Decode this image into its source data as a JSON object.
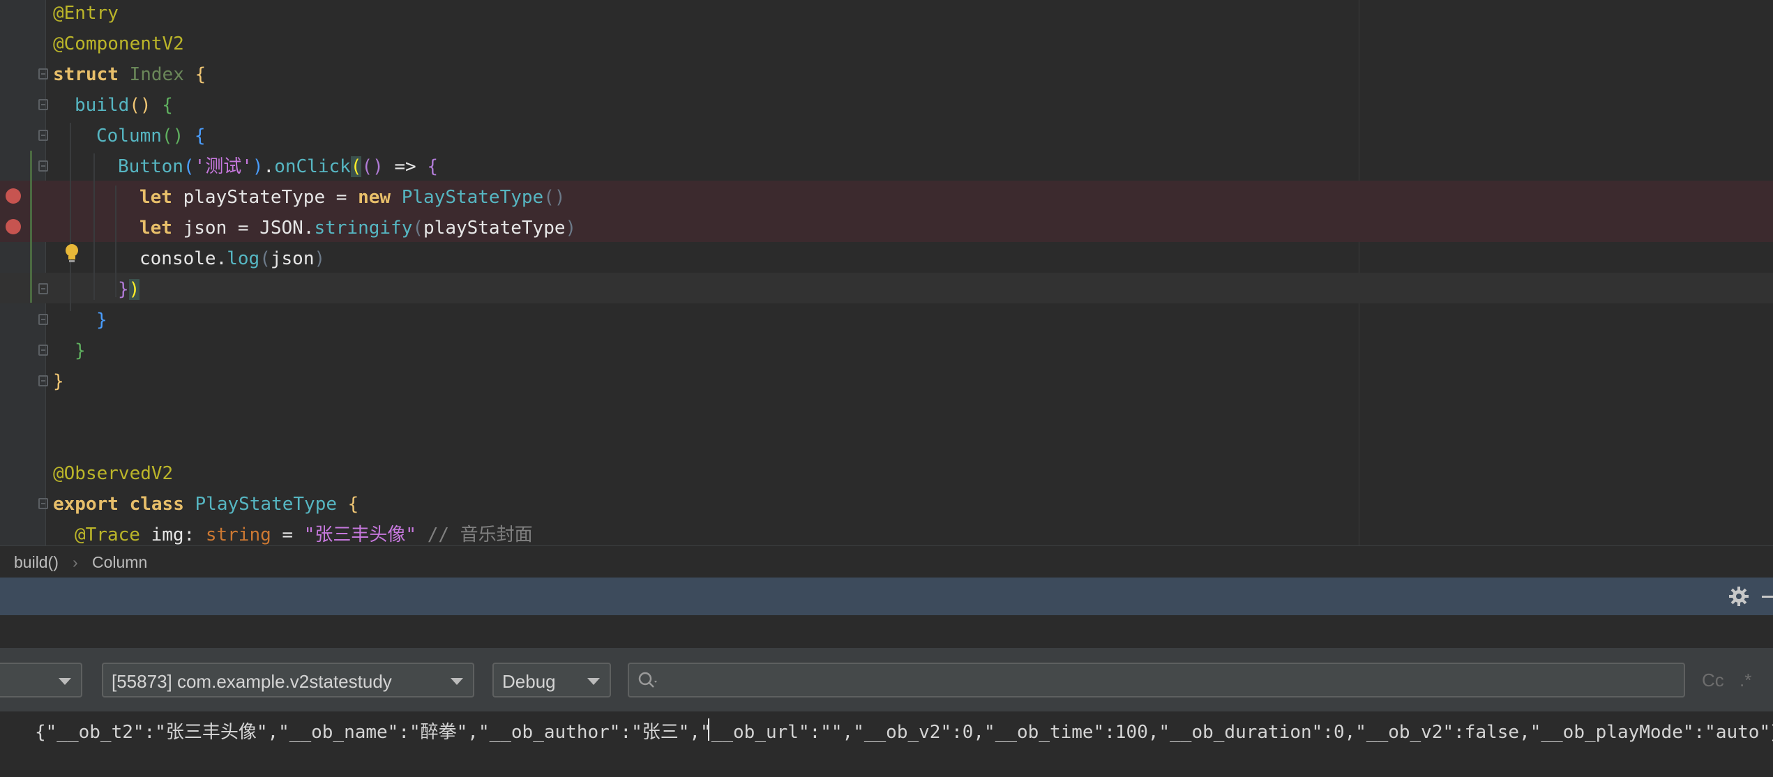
{
  "editor": {
    "lines": {
      "l1": {
        "ann": "@Entry"
      },
      "l2": {
        "ann": "@ComponentV2"
      },
      "l3": {
        "kw": "struct",
        "cls": "Index",
        "brace": "{"
      },
      "l4": {
        "fn": "build",
        "paren": "()",
        "brace": "{"
      },
      "l5": {
        "type": "Column",
        "paren": "()",
        "brace": "{"
      },
      "l6": {
        "type": "Button",
        "open": "(",
        "str": "'测试'",
        "close": ")",
        "dot": ".",
        "fn": "onClick",
        "p1": "(",
        "p2": "()",
        "arrow": " => ",
        "brace": "{"
      },
      "l7": {
        "kw": "let",
        "id": " playStateType = ",
        "kw2": "new",
        "type": "PlayStateType",
        "paren": "()"
      },
      "l8": {
        "kw": "let",
        "id": " json = JSON.",
        "fn": "stringify",
        "open": "(",
        "arg": "playStateType",
        "close": ")"
      },
      "l9": {
        "id": "console.",
        "fn": "log",
        "open": "(",
        "arg": "json",
        "close": ")"
      },
      "l10": {
        "brace": "}",
        "paren": ")"
      },
      "l11": {
        "brace": "}"
      },
      "l12": {
        "brace": "}"
      },
      "l13": {
        "brace": "}"
      },
      "l15": {
        "ann": "@ObservedV2"
      },
      "l16": {
        "kw": "export",
        "kw2": "class",
        "type": "PlayStateType",
        "brace": "{"
      },
      "l17": {
        "ann": "@Trace",
        "id": " img: ",
        "ty": "string",
        "eq": " = ",
        "str": "\"张三丰头像\"",
        "cmt": " // 音乐封面"
      }
    }
  },
  "breadcrumb": {
    "item1": "build()",
    "sep": "›",
    "item2": "Column"
  },
  "filter": {
    "device_label": "",
    "process_label": "[55873] com.example.v2statestudy",
    "level_label": "Debug",
    "search_placeholder": "",
    "case_label": "Cc",
    "regex_label": ".*"
  },
  "log": {
    "before_caret": "{\"__ob_t2\":\"张三丰头像\",\"__ob_name\":\"醉拳\",\"__ob_author\":\"张三\",\"",
    "after_caret": "__ob_url\":\"\",\"__ob_v2\":0,\"__ob_time\":100,\"__ob_duration\":0,\"__ob_v2\":false,\"__ob_playMode\":\"auto\"}"
  },
  "colors": {
    "breakpoint": "#c75450",
    "breakpoint_line": "#3c2a2e",
    "tool_header": "#3d4b5c"
  },
  "icons": [
    "breakpoint-icon",
    "fold-icon",
    "lightbulb-icon",
    "gear-icon",
    "minimize-icon",
    "search-icon",
    "chevron-down-icon"
  ]
}
